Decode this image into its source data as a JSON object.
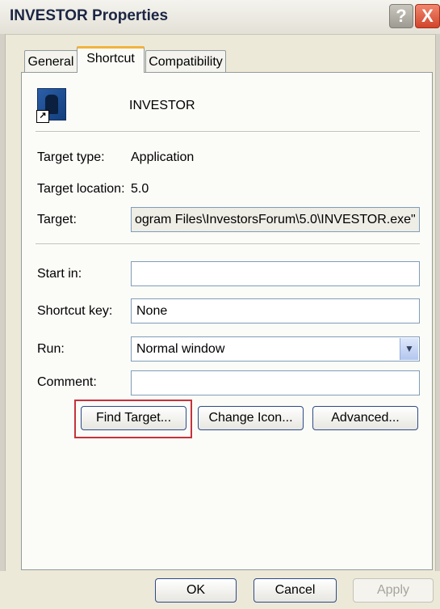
{
  "window": {
    "title": "INVESTOR Properties",
    "help_glyph": "?",
    "close_glyph": "X"
  },
  "tabs": [
    {
      "label": "General",
      "selected": false
    },
    {
      "label": "Shortcut",
      "selected": true
    },
    {
      "label": "Compatibility",
      "selected": false
    }
  ],
  "shortcut": {
    "app_name": "INVESTOR",
    "icon": "investor-app-icon",
    "shortcut_arrow": "↗",
    "target_type_label": "Target type:",
    "target_type_value": "Application",
    "target_location_label": "Target location:",
    "target_location_value": "5.0",
    "target_label": "Target:",
    "target_value": "ogram Files\\InvestorsForum\\5.0\\INVESTOR.exe\"",
    "start_in_label": "Start in:",
    "start_in_value": "",
    "shortcut_key_label": "Shortcut key:",
    "shortcut_key_value": "None",
    "run_label": "Run:",
    "run_value": "Normal window",
    "comment_label": "Comment:",
    "comment_value": ""
  },
  "buttons": {
    "find_target": "Find Target...",
    "change_icon": "Change Icon...",
    "advanced": "Advanced...",
    "ok": "OK",
    "cancel": "Cancel",
    "apply": "Apply"
  },
  "colors": {
    "highlight": "#c6323b",
    "tab_accent": "#f2b33d"
  }
}
